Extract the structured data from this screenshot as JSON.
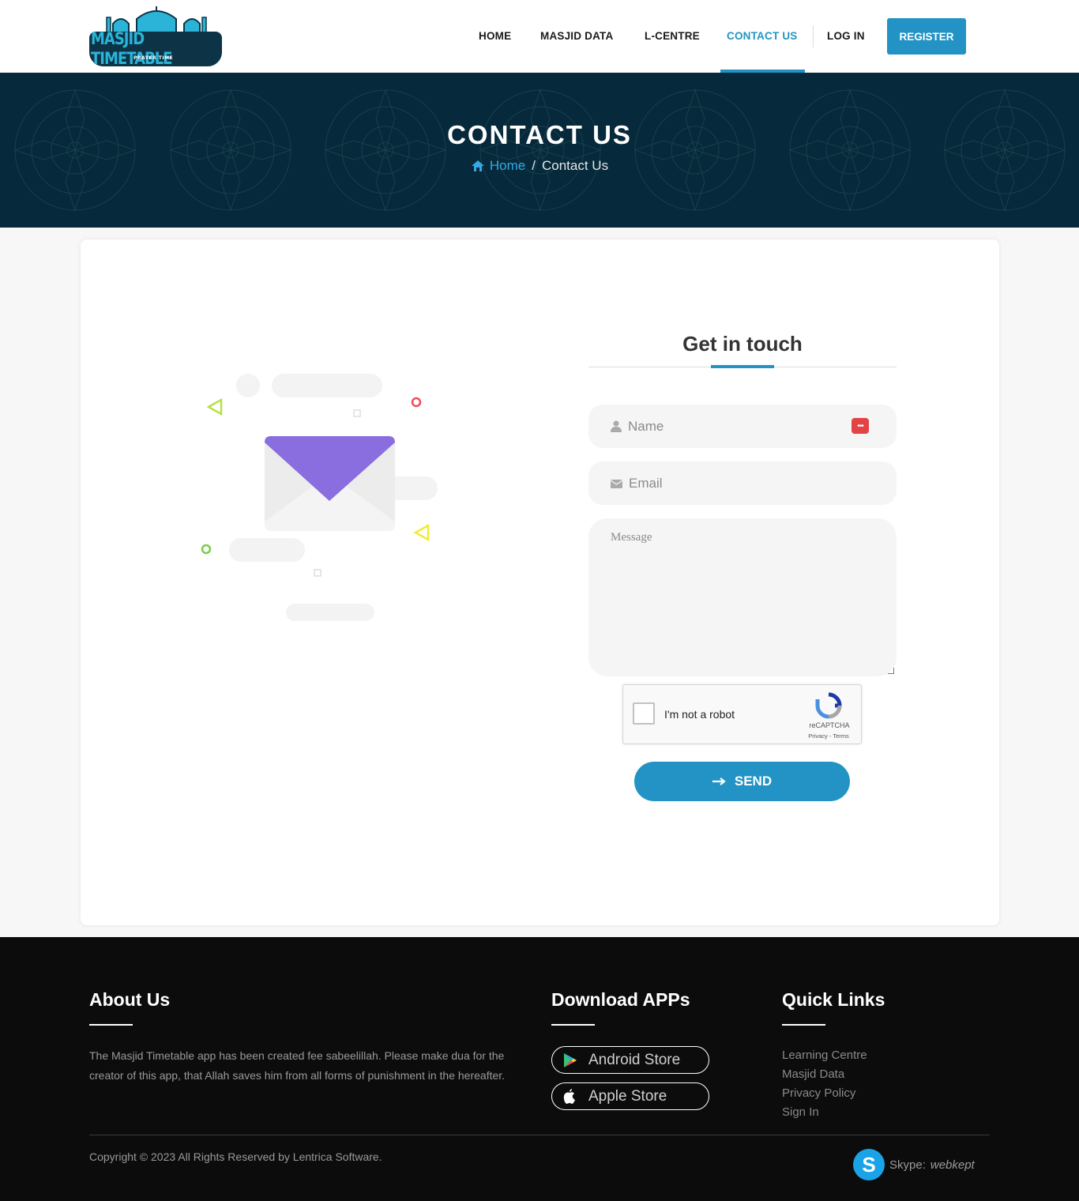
{
  "logo": {
    "title": "MASJID TIMETABLE",
    "subtitle": "PRAYER TIME"
  },
  "nav": {
    "items": [
      {
        "label": "HOME"
      },
      {
        "label": "MASJID DATA"
      },
      {
        "label": "L-CENTRE"
      },
      {
        "label": "CONTACT US",
        "active": true
      },
      {
        "label": "LOG IN"
      }
    ],
    "register_label": "REGISTER"
  },
  "banner": {
    "title": "CONTACT US",
    "breadcrumb": {
      "home": "Home",
      "separator": "/",
      "current": "Contact Us"
    }
  },
  "form": {
    "title": "Get in touch",
    "name_placeholder": "Name",
    "email_placeholder": "Email",
    "message_placeholder": "Message",
    "captcha": {
      "label": "I'm not a robot",
      "brand": "reCAPTCHA",
      "links": "Privacy - Terms"
    },
    "send_label": "SEND"
  },
  "footer": {
    "about": {
      "title": "About Us",
      "text": "The Masjid Timetable app has been created fee sabeelillah. Please make dua for the creator of this app, that Allah saves him from all forms of punishment in the hereafter."
    },
    "apps": {
      "title": "Download APPs",
      "android": "Android Store",
      "apple": "Apple Store"
    },
    "links": {
      "title": "Quick Links",
      "items": [
        "Learning Centre",
        "Masjid Data",
        "Privacy Policy",
        "Sign In"
      ]
    },
    "copyright": "Copyright © 2023 All Rights Reserved by Lentrica Software.",
    "skype_label": "Skype:",
    "skype_handle": "webkept"
  },
  "colors": {
    "accent": "#2293c4",
    "banner": "#06293b",
    "footer": "#0c0c0d",
    "envelope": "#8a6ddf"
  }
}
